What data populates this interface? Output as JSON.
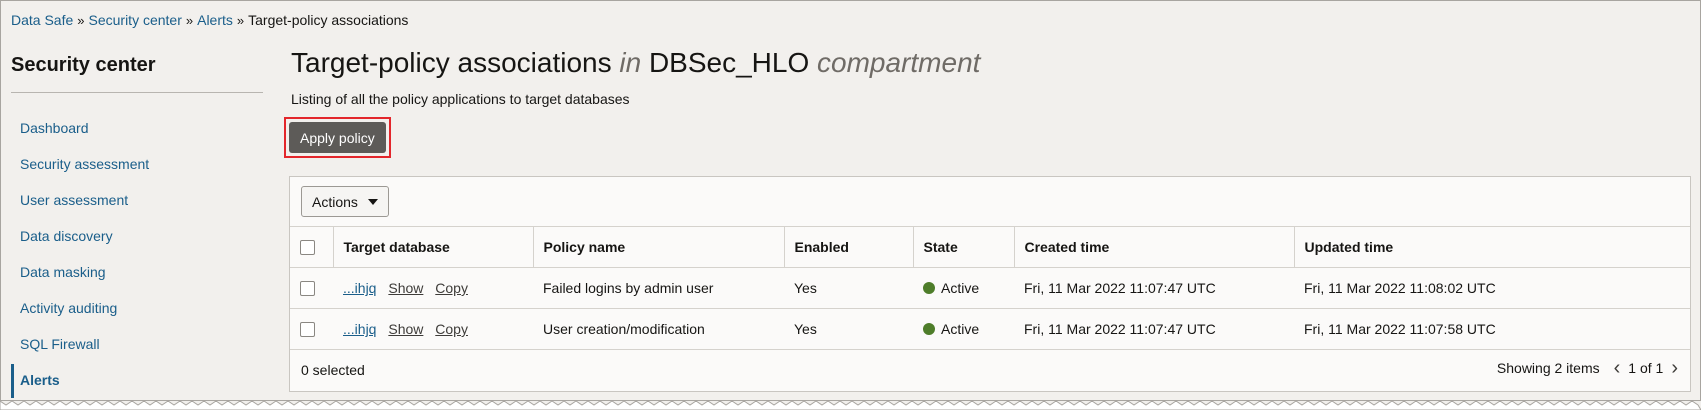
{
  "breadcrumb": {
    "items": [
      "Data Safe",
      "Security center",
      "Alerts"
    ],
    "separator": "»",
    "current": "Target-policy associations"
  },
  "sidebar": {
    "title": "Security center",
    "items": [
      {
        "label": "Dashboard"
      },
      {
        "label": "Security assessment"
      },
      {
        "label": "User assessment"
      },
      {
        "label": "Data discovery"
      },
      {
        "label": "Data masking"
      },
      {
        "label": "Activity auditing"
      },
      {
        "label": "SQL Firewall"
      },
      {
        "label": "Alerts",
        "active": true
      }
    ]
  },
  "header": {
    "title": "Target-policy associations",
    "in_word": "in",
    "compartment_name": "DBSec_HLO",
    "compartment_word": "compartment",
    "subtitle": "Listing of all the policy applications to target databases"
  },
  "toolbar": {
    "apply_policy_label": "Apply policy",
    "actions_label": "Actions"
  },
  "table": {
    "columns": [
      "Target database",
      "Policy name",
      "Enabled",
      "State",
      "Created time",
      "Updated time"
    ],
    "rows": [
      {
        "target": "...ihjq",
        "show": "Show",
        "copy": "Copy",
        "policy": "Failed logins by admin user",
        "enabled": "Yes",
        "state": "Active",
        "created": "Fri, 11 Mar 2022 11:07:47 UTC",
        "updated": "Fri, 11 Mar 2022 11:08:02 UTC"
      },
      {
        "target": "...ihjq",
        "show": "Show",
        "copy": "Copy",
        "policy": "User creation/modification",
        "enabled": "Yes",
        "state": "Active",
        "created": "Fri, 11 Mar 2022 11:07:47 UTC",
        "updated": "Fri, 11 Mar 2022 11:07:58 UTC"
      }
    ]
  },
  "footer": {
    "selected": "0 selected",
    "showing": "Showing 2 items",
    "page": "1 of 1"
  },
  "colors": {
    "link": "#1a5e8a",
    "highlight_border": "#e3262b",
    "primary_button": "#5d5b58",
    "active_state": "#4e7d2a"
  }
}
